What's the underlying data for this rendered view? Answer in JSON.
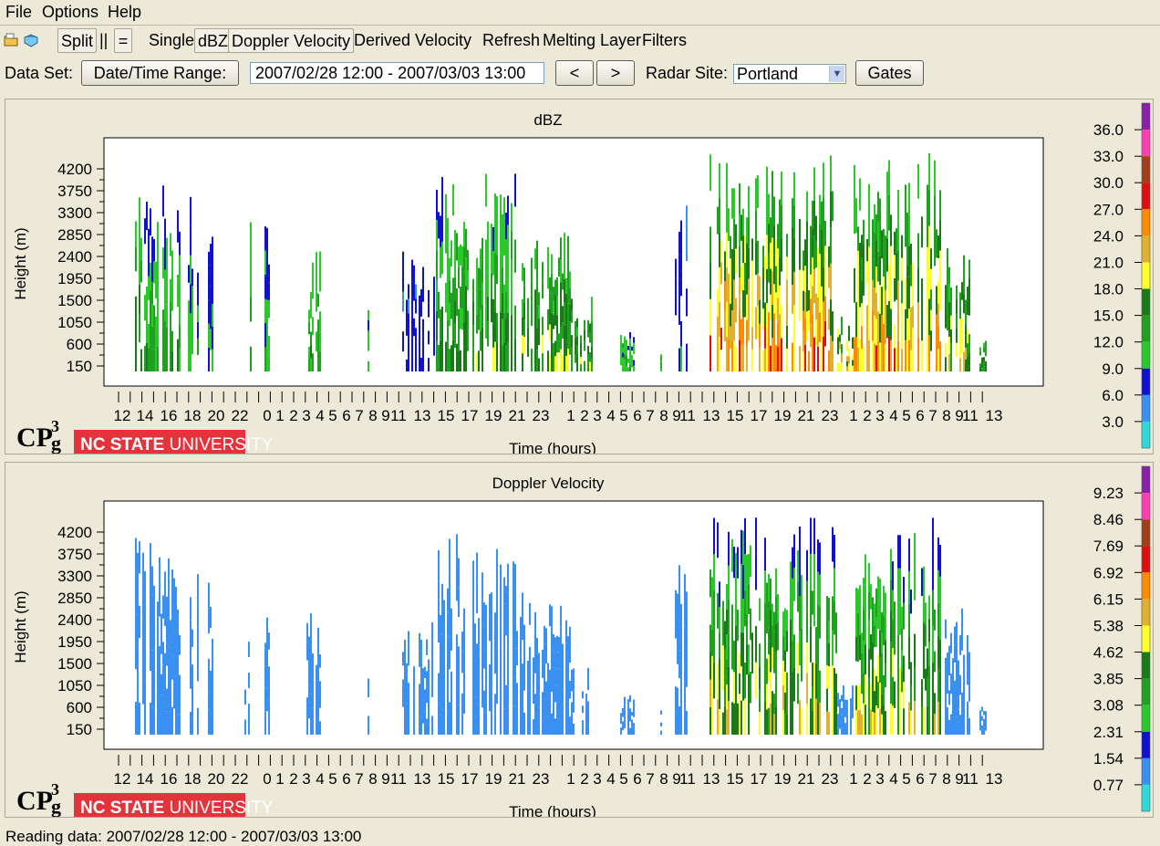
{
  "menu": [
    "File",
    "Options",
    "Help"
  ],
  "toolbar": {
    "icons": [
      "open-folder-icon",
      "open-book-icon"
    ],
    "split_label": "Split",
    "vertical_label": "||",
    "horizontal_label": "=",
    "single_label": "Single",
    "dbz_label": "dBZ",
    "doppler_label": "Doppler Velocity",
    "derived_label": "Derived Velocity",
    "refresh_label": "Refresh",
    "melting_label": "Melting Layer",
    "filters_label": "Filters"
  },
  "dataset": {
    "label": "Data Set:",
    "range_button": "Date/Time Range:",
    "range_value": "2007/02/28 12:00 - 2007/03/03 13:00",
    "prev_label": "<",
    "next_label": ">",
    "site_label": "Radar Site:",
    "site_value": "Portland",
    "gates_label": "Gates"
  },
  "logo": {
    "cp_text": "CP",
    "cp_sub": "g",
    "cp_sup": "3",
    "ncsu_bold": "NC STATE",
    "ncsu_light": " UNIVERSITY"
  },
  "chart_data": [
    {
      "type": "heatmap",
      "title": "dBZ",
      "xlabel": "Time (hours)",
      "ylabel": "Height (m)",
      "y_ticks": [
        150,
        600,
        1050,
        1500,
        1950,
        2400,
        2850,
        3300,
        3750,
        4200
      ],
      "x_tick_labels": [
        "12",
        "14",
        "16",
        "18",
        "20",
        "22",
        "0",
        "1",
        "2",
        "3",
        "4",
        "5",
        "6",
        "7",
        "8",
        "9",
        "11",
        "13",
        "15",
        "17",
        "19",
        "21",
        "23",
        "1",
        "2",
        "3",
        "4",
        "5",
        "6",
        "7",
        "8",
        "9",
        "11",
        "13",
        "15",
        "17",
        "19",
        "21",
        "23",
        "1",
        "2",
        "3",
        "4",
        "5",
        "6",
        "7",
        "8",
        "9",
        "11",
        "13"
      ],
      "colorbar": {
        "labels": [
          "36.0",
          "33.0",
          "30.0",
          "27.0",
          "24.0",
          "21.0",
          "18.0",
          "15.0",
          "12.0",
          "9.0",
          "6.0",
          "3.0"
        ],
        "colors": [
          "#8b1fa8",
          "#ff3fb0",
          "#a0401a",
          "#e01010",
          "#ff8c00",
          "#e0b030",
          "#ffff30",
          "#1a7a1a",
          "#1fa01f",
          "#2ac82a",
          "#1010d0",
          "#3a90f0",
          "#30d8d8"
        ]
      }
    },
    {
      "type": "heatmap",
      "title": "Doppler Velocity",
      "xlabel": "Time (hours)",
      "ylabel": "Height (m)",
      "y_ticks": [
        150,
        600,
        1050,
        1500,
        1950,
        2400,
        2850,
        3300,
        3750,
        4200
      ],
      "x_tick_labels": [
        "12",
        "14",
        "16",
        "18",
        "20",
        "22",
        "0",
        "1",
        "2",
        "3",
        "4",
        "5",
        "6",
        "7",
        "8",
        "9",
        "11",
        "13",
        "15",
        "17",
        "19",
        "21",
        "23",
        "1",
        "2",
        "3",
        "4",
        "5",
        "6",
        "7",
        "8",
        "9",
        "11",
        "13",
        "15",
        "17",
        "19",
        "21",
        "23",
        "1",
        "2",
        "3",
        "4",
        "5",
        "6",
        "7",
        "8",
        "9",
        "11",
        "13"
      ],
      "colorbar": {
        "labels": [
          "9.23",
          "8.46",
          "7.69",
          "6.92",
          "6.15",
          "5.38",
          "4.62",
          "3.85",
          "3.08",
          "2.31",
          "1.54",
          "0.77"
        ],
        "colors": [
          "#8b1fa8",
          "#ff3fb0",
          "#a0401a",
          "#e01010",
          "#ff8c00",
          "#e0b030",
          "#ffff30",
          "#1a7a1a",
          "#1fa01f",
          "#2ac82a",
          "#1010d0",
          "#3a90f0",
          "#30d8d8"
        ]
      }
    }
  ],
  "status": "Reading data: 2007/02/28 12:00 - 2007/03/03 13:00"
}
